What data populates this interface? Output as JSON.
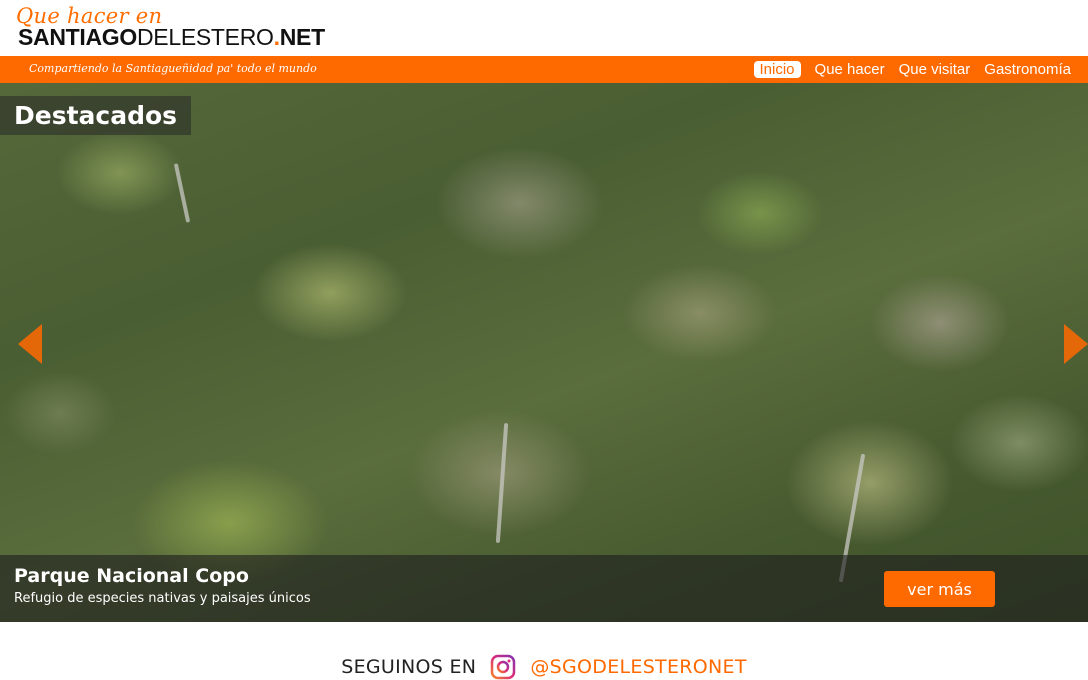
{
  "header": {
    "logo_script": "Que hacer en",
    "logo_bold_1": "SANTIAGO",
    "logo_light": "DELESTERO",
    "logo_dot": ".",
    "logo_bold_2": "NET"
  },
  "navbar": {
    "tagline": "Compartiendo la Santiagueñidad pa' todo el mundo",
    "items": [
      {
        "label": "Inicio",
        "active": true
      },
      {
        "label": "Que hacer",
        "active": false
      },
      {
        "label": "Que visitar",
        "active": false
      },
      {
        "label": "Gastronomía",
        "active": false
      }
    ]
  },
  "hero": {
    "section_title": "Destacados",
    "slide": {
      "title": "Parque Nacional Copo",
      "subtitle": "Refugio de especies nativas y paisajes únicos",
      "button_label": "ver más"
    },
    "prev_icon": "chevron-left-icon",
    "next_icon": "chevron-right-icon"
  },
  "footer": {
    "follow_label": "SEGUINOS EN",
    "instagram_icon": "instagram-icon",
    "handle": "@SGODELESTERONET"
  },
  "colors": {
    "accent": "#ff6a00",
    "text_dark": "#222222",
    "white": "#ffffff"
  }
}
